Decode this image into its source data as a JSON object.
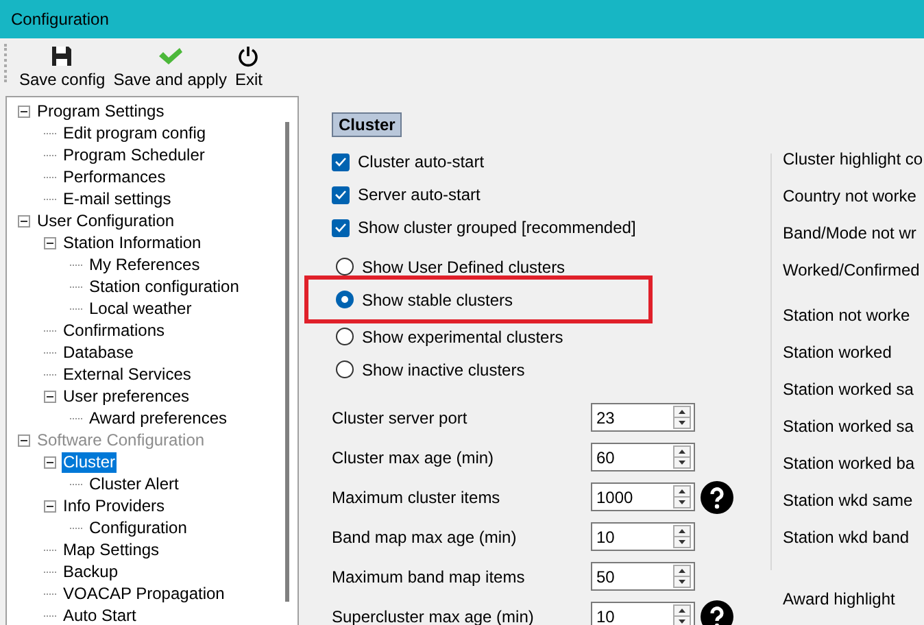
{
  "window": {
    "title": "Configuration"
  },
  "toolbar": [
    {
      "label": "Save config",
      "kind": "save"
    },
    {
      "label": "Save and apply",
      "kind": "apply"
    },
    {
      "label": "Exit",
      "kind": "exit"
    }
  ],
  "tree": [
    {
      "label": "Program Settings",
      "selected": false,
      "dimmed": false,
      "expanded": true,
      "children": [
        {
          "label": "Edit program config",
          "selected": false,
          "dimmed": false
        },
        {
          "label": "Program Scheduler",
          "selected": false,
          "dimmed": false
        },
        {
          "label": "Performances",
          "selected": false,
          "dimmed": false
        },
        {
          "label": "E-mail settings",
          "selected": false,
          "dimmed": false
        }
      ]
    },
    {
      "label": "User Configuration",
      "selected": false,
      "dimmed": false,
      "expanded": true,
      "children": [
        {
          "label": "Station Information",
          "selected": false,
          "dimmed": false,
          "expanded": true,
          "children": [
            {
              "label": "My References",
              "selected": false,
              "dimmed": false
            },
            {
              "label": "Station configuration",
              "selected": false,
              "dimmed": false
            },
            {
              "label": "Local weather",
              "selected": false,
              "dimmed": false
            }
          ]
        },
        {
          "label": "Confirmations",
          "selected": false,
          "dimmed": false
        },
        {
          "label": "Database",
          "selected": false,
          "dimmed": false
        },
        {
          "label": "External Services",
          "selected": false,
          "dimmed": false
        },
        {
          "label": "User preferences",
          "selected": false,
          "dimmed": false,
          "expanded": true,
          "children": [
            {
              "label": "Award preferences",
              "selected": false,
              "dimmed": false
            }
          ]
        }
      ]
    },
    {
      "label": "Software Configuration",
      "selected": false,
      "dimmed": true,
      "expanded": true,
      "children": [
        {
          "label": "Cluster",
          "selected": true,
          "dimmed": false,
          "expanded": true,
          "children": [
            {
              "label": "Cluster Alert",
              "selected": false,
              "dimmed": false
            }
          ]
        },
        {
          "label": "Info Providers",
          "selected": false,
          "dimmed": false,
          "expanded": true,
          "children": [
            {
              "label": "Configuration",
              "selected": false,
              "dimmed": false
            }
          ]
        },
        {
          "label": "Map Settings",
          "selected": false,
          "dimmed": false
        },
        {
          "label": "Backup",
          "selected": false,
          "dimmed": false
        },
        {
          "label": "VOACAP Propagation",
          "selected": false,
          "dimmed": false
        },
        {
          "label": "Auto Start",
          "selected": false,
          "dimmed": false
        }
      ]
    }
  ],
  "section_title": "Cluster",
  "checkboxes": [
    {
      "label": "Cluster auto-start",
      "checked": true
    },
    {
      "label": "Server auto-start",
      "checked": true
    },
    {
      "label": "Show cluster grouped [recommended]",
      "checked": true
    }
  ],
  "radios": [
    {
      "label": "Show User Defined clusters",
      "selected": false,
      "highlighted": false
    },
    {
      "label": "Show stable clusters",
      "selected": true,
      "highlighted": true
    },
    {
      "label": "Show experimental clusters",
      "selected": false,
      "highlighted": false
    },
    {
      "label": "Show inactive clusters",
      "selected": false,
      "highlighted": false
    }
  ],
  "spinners": [
    {
      "label": "Cluster server port",
      "value": "23",
      "help": false
    },
    {
      "label": "Cluster max age (min)",
      "value": "60",
      "help": false
    },
    {
      "label": "Maximum cluster items",
      "value": "1000",
      "help": true
    },
    {
      "label": "Band map max age (min)",
      "value": "10",
      "help": false
    },
    {
      "label": "Maximum band map items",
      "value": "50",
      "help": false
    },
    {
      "label": "Supercluster max age (min)",
      "value": "10",
      "help": true
    }
  ],
  "highlight_group": {
    "title": "Cluster highlight co",
    "items": [
      "Country not worke",
      "Band/Mode not wr",
      "Worked/Confirmed",
      "Station not worke",
      "Station worked",
      "Station worked sa",
      "Station worked sa",
      "Station worked ba",
      "Station wkd same",
      "Station wkd band"
    ],
    "award_title": "Award highlight"
  }
}
